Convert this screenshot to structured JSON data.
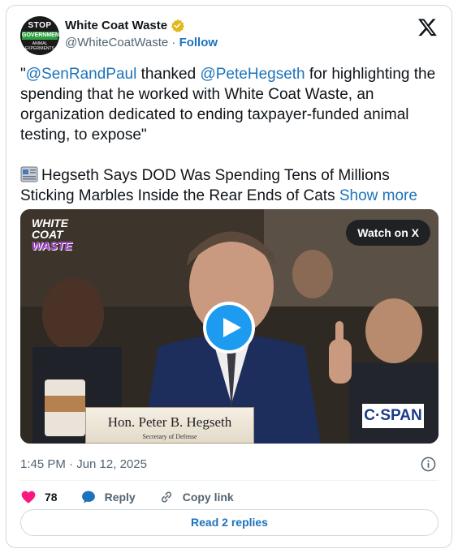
{
  "author": {
    "display_name": "White Coat Waste",
    "handle": "@WhiteCoatWaste",
    "separator": "·",
    "follow_label": "Follow",
    "avatar": {
      "top_text": "STOP",
      "band_text": "GOVERNMENT",
      "bottom_text": "ANIMAL EXPERIMENTS"
    }
  },
  "tweet": {
    "quote_open": "\"",
    "mention_1": "@SenRandPaul",
    "text_1": " thanked ",
    "mention_2": "@PeteHegseth",
    "text_2": " for highlighting the spending that he worked with White Coat Waste, an organization dedicated to ending taxpayer-funded animal testing, to expose\"",
    "headline": "Hegseth Says DOD Was Spending Tens of Millions Sticking Marbles Inside the Rear Ends of Cats",
    "show_more": "Show more"
  },
  "media": {
    "watermark_lines": [
      "WHITE",
      "COAT",
      "WASTE"
    ],
    "watch_label": "Watch on X",
    "nameplate_name": "Hon. Peter B. Hegseth",
    "nameplate_title": "Secretary of Defense",
    "broadcaster": "C·SPAN"
  },
  "meta": {
    "timestamp": "1:45 PM · Jun 12, 2025"
  },
  "actions": {
    "like_count": "78",
    "reply_label": "Reply",
    "copy_label": "Copy link",
    "read_replies_label": "Read 2 replies"
  },
  "colors": {
    "link": "#1d73bb",
    "muted": "#536471",
    "like": "#f91880",
    "play": "#1d9bf0",
    "verified": "#e2b719"
  },
  "icons": [
    "x-logo-icon",
    "verified-badge-icon",
    "newspaper-icon",
    "play-icon",
    "info-icon",
    "heart-icon",
    "reply-icon",
    "link-icon"
  ]
}
